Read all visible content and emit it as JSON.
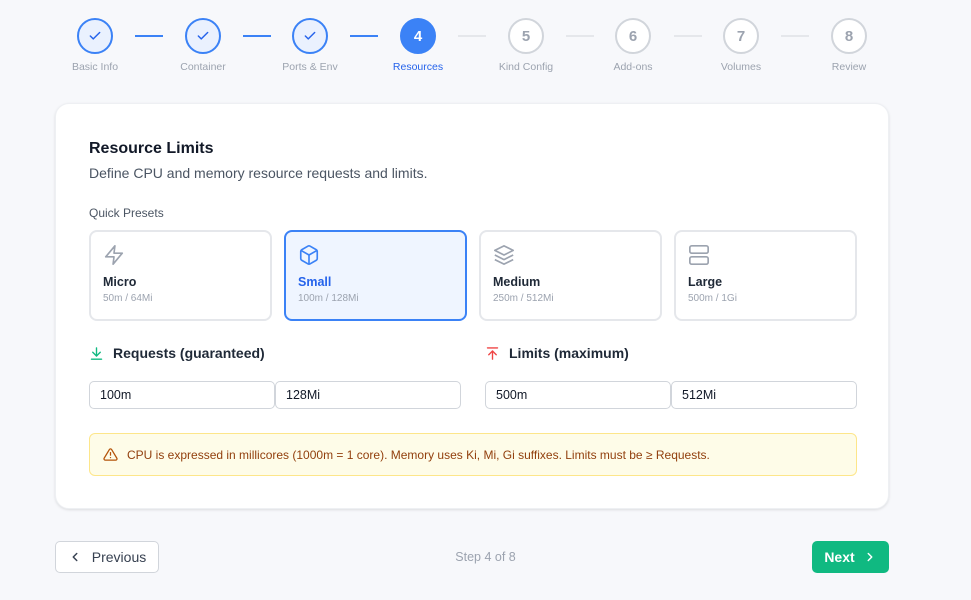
{
  "stepper": {
    "steps": [
      {
        "number": "1",
        "label": "Basic Info",
        "state": "done"
      },
      {
        "number": "2",
        "label": "Container",
        "state": "done"
      },
      {
        "number": "3",
        "label": "Ports & Env",
        "state": "done"
      },
      {
        "number": "4",
        "label": "Resources",
        "state": "active"
      },
      {
        "number": "5",
        "label": "Kind Config",
        "state": "todo"
      },
      {
        "number": "6",
        "label": "Add-ons",
        "state": "todo"
      },
      {
        "number": "7",
        "label": "Volumes",
        "state": "todo"
      },
      {
        "number": "8",
        "label": "Review",
        "state": "todo"
      }
    ]
  },
  "card": {
    "title": "Resource Limits",
    "subtitle": "Define CPU and memory resource requests and limits.",
    "presets_label": "Quick Presets",
    "presets": [
      {
        "name": "Micro",
        "value": "50m / 64Mi",
        "icon": "lightning-icon",
        "selected": false
      },
      {
        "name": "Small",
        "value": "100m / 128Mi",
        "icon": "box-icon",
        "selected": true
      },
      {
        "name": "Medium",
        "value": "250m / 512Mi",
        "icon": "layers-icon",
        "selected": false
      },
      {
        "name": "Large",
        "value": "500m / 1Gi",
        "icon": "server-icon",
        "selected": false
      }
    ],
    "requests": {
      "heading": "Requests (guaranteed)",
      "cpu": "100m",
      "memory": "128Mi"
    },
    "limits": {
      "heading": "Limits (maximum)",
      "cpu": "500m",
      "memory": "512Mi"
    },
    "notice": "CPU is expressed in millicores (1000m = 1 core). Memory uses Ki, Mi, Gi suffixes. Limits must be ≥ Requests."
  },
  "footer": {
    "previous_label": "Previous",
    "step_count": "Step 4 of 8",
    "next_label": "Next"
  },
  "colors": {
    "accent": "#3b82f6",
    "next_button": "#10b981",
    "warning_bg": "#fefce8",
    "requests_icon": "#10b981",
    "limits_icon": "#ef4444"
  }
}
